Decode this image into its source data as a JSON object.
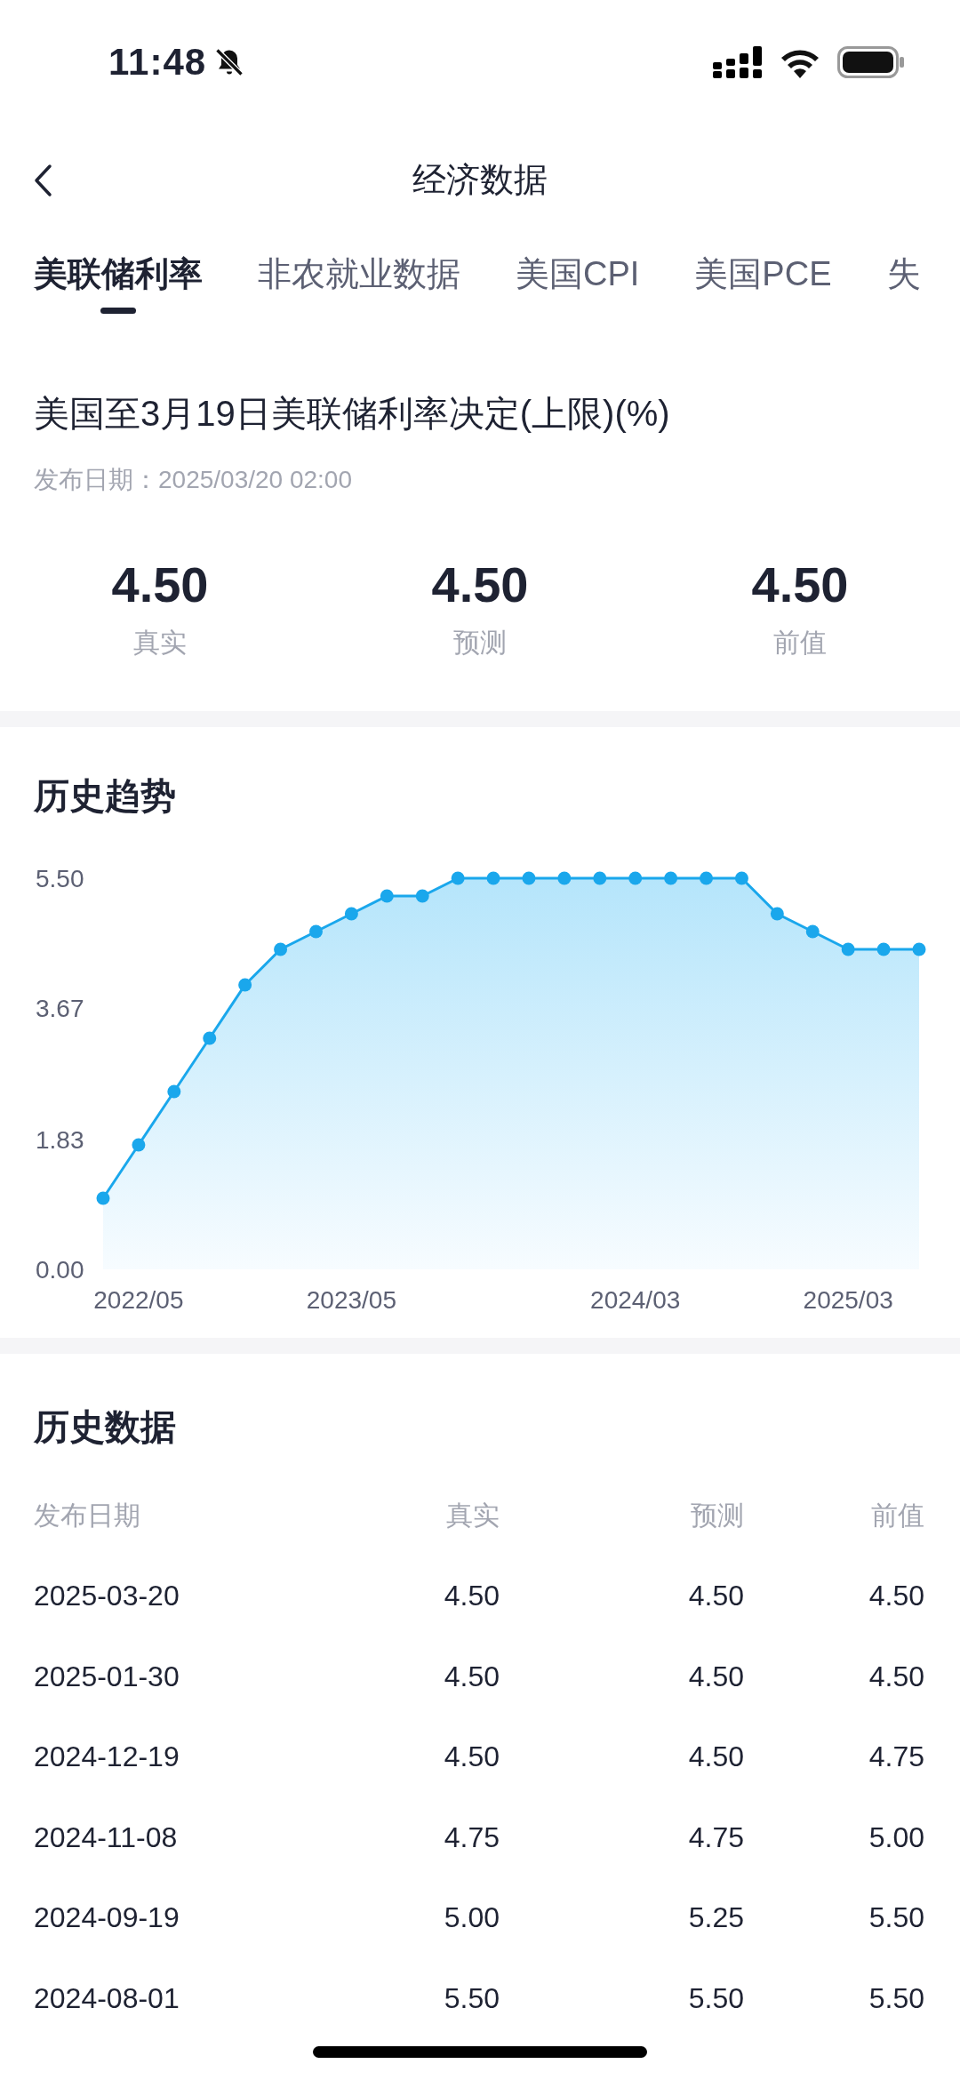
{
  "status_bar": {
    "time": "11:48"
  },
  "nav": {
    "title": "经济数据"
  },
  "tabs": [
    {
      "label": "美联储利率",
      "selected": true
    },
    {
      "label": "非农就业数据",
      "selected": false
    },
    {
      "label": "美国CPI",
      "selected": false
    },
    {
      "label": "美国PCE",
      "selected": false
    },
    {
      "label": "失",
      "selected": false
    }
  ],
  "headline": {
    "title": "美国至3月19日美联储利率决定(上限)(%)",
    "release": "发布日期：2025/03/20 02:00",
    "stats": [
      {
        "value": "4.50",
        "label": "真实"
      },
      {
        "value": "4.50",
        "label": "预测"
      },
      {
        "value": "4.50",
        "label": "前值"
      }
    ]
  },
  "trend": {
    "title": "历史趋势",
    "chart_data": {
      "type": "line",
      "categories": [
        null,
        "2022/05",
        null,
        null,
        null,
        null,
        null,
        "2023/05",
        null,
        null,
        null,
        null,
        null,
        null,
        null,
        "2024/03",
        null,
        null,
        null,
        null,
        null,
        "2025/03",
        null,
        null
      ],
      "series": [
        {
          "color": "#1aa7ec",
          "marker": "circle",
          "values": [
            1.0,
            1.75,
            2.5,
            3.25,
            4.0,
            4.5,
            4.75,
            5.0,
            5.25,
            5.25,
            5.5,
            5.5,
            5.5,
            5.5,
            5.5,
            5.5,
            5.5,
            5.5,
            5.5,
            5.0,
            4.75,
            4.5,
            4.5,
            4.5
          ]
        }
      ],
      "ylim": [
        0,
        5.5
      ],
      "yticks": [
        {
          "value": 0,
          "label": "0.00"
        },
        {
          "value": 1.83,
          "label": "1.83"
        },
        {
          "value": 3.67,
          "label": "3.67"
        },
        {
          "value": 5.5,
          "label": "5.50"
        }
      ]
    }
  },
  "history": {
    "title": "历史数据",
    "columns": [
      "发布日期",
      "真实",
      "预测",
      "前值"
    ],
    "rows": [
      [
        "2025-03-20",
        "4.50",
        "4.50",
        "4.50"
      ],
      [
        "2025-01-30",
        "4.50",
        "4.50",
        "4.50"
      ],
      [
        "2024-12-19",
        "4.50",
        "4.50",
        "4.75"
      ],
      [
        "2024-11-08",
        "4.75",
        "4.75",
        "5.00"
      ],
      [
        "2024-09-19",
        "5.00",
        "5.25",
        "5.50"
      ],
      [
        "2024-08-01",
        "5.50",
        "5.50",
        "5.50"
      ]
    ]
  }
}
